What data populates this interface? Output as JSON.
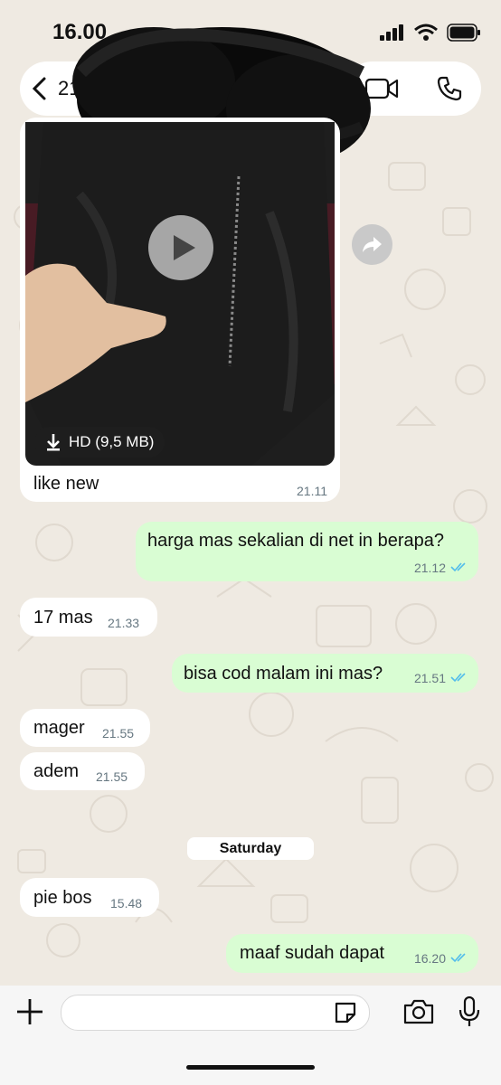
{
  "status": {
    "time": "16.00"
  },
  "header": {
    "back_count": "213"
  },
  "video": {
    "hd_label": "HD (9,5 MB)"
  },
  "messages": [
    {
      "text": "like new",
      "time": "21.11",
      "dir": "in"
    },
    {
      "text": "harga mas sekalian di net in berapa?",
      "time": "21.12",
      "dir": "out"
    },
    {
      "text": "17 mas",
      "time": "21.33",
      "dir": "in"
    },
    {
      "text": "bisa cod malam ini mas?",
      "time": "21.51",
      "dir": "out"
    },
    {
      "text": "mager",
      "time": "21.55",
      "dir": "in"
    },
    {
      "text": "adem",
      "time": "21.55",
      "dir": "in"
    },
    {
      "text": "pie bos",
      "time": "15.48",
      "dir": "in"
    },
    {
      "text": "maaf sudah dapat",
      "time": "16.20",
      "dir": "out"
    }
  ],
  "date_separator": "Saturday",
  "colors": {
    "incoming": "#ffffff",
    "outgoing": "#d9fdd3",
    "read_tick": "#53bdeb",
    "background": "#efeae2"
  }
}
